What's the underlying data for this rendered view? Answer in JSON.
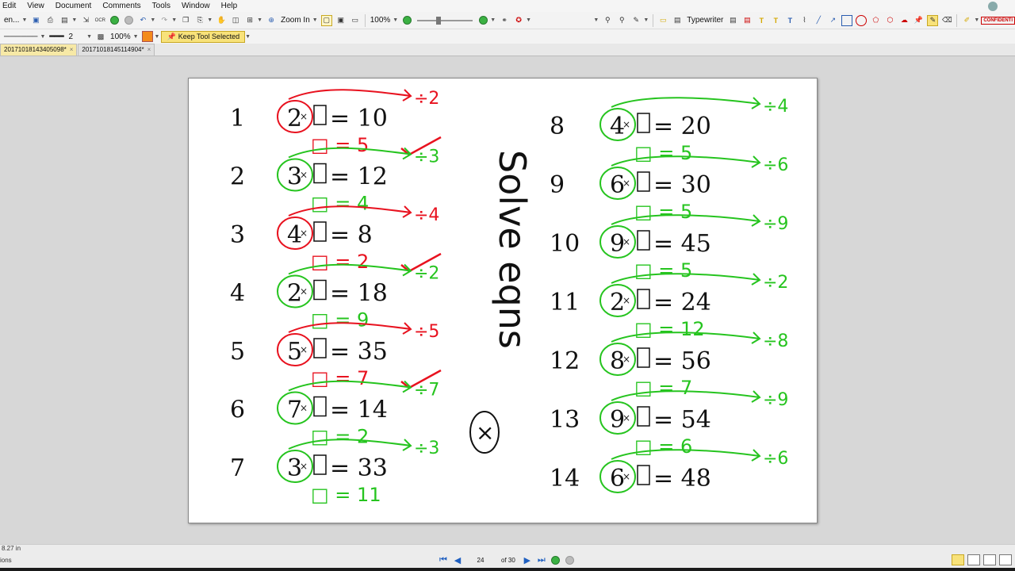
{
  "menu": [
    "Edit",
    "View",
    "Document",
    "Comments",
    "Tools",
    "Window",
    "Help"
  ],
  "toolbar": {
    "zoom_in_label": "Zoom In",
    "zoom_percent": "100%",
    "typewriter_label": "Typewriter",
    "confidential_label": "CONFIDENTI"
  },
  "toolbar2": {
    "left_label": "en...",
    "line_width": "2",
    "opacity": "100%",
    "keep_tool": "Keep Tool Selected"
  },
  "tabs": [
    {
      "label": "20171018143405098*",
      "active": true
    },
    {
      "label": "20171018145114904*",
      "active": false
    }
  ],
  "status": {
    "page_size": "8.27 in",
    "options_label": "ions",
    "current_page": "24",
    "of_pages": "of 30"
  },
  "worksheet": {
    "left": [
      {
        "n": "1",
        "a": "2",
        "p": "10",
        "ann": "÷2",
        "ans": "□ = 5",
        "col": "red"
      },
      {
        "n": "2",
        "a": "3",
        "p": "12",
        "ann": "÷3",
        "ans": "□ = 4",
        "col": "green"
      },
      {
        "n": "3",
        "a": "4",
        "p": "8",
        "ann": "÷4",
        "ans": "□ = 2",
        "col": "red"
      },
      {
        "n": "4",
        "a": "2",
        "p": "18",
        "ann": "÷2",
        "ans": "□ = 9",
        "col": "green"
      },
      {
        "n": "5",
        "a": "5",
        "p": "35",
        "ann": "÷5",
        "ans": "□ = 7",
        "col": "red"
      },
      {
        "n": "6",
        "a": "7",
        "p": "14",
        "ann": "÷7",
        "ans": "□ = 2",
        "col": "green"
      },
      {
        "n": "7",
        "a": "3",
        "p": "33",
        "ann": "÷3",
        "ans": "□ = 11",
        "col": "green"
      }
    ],
    "right": [
      {
        "n": "8",
        "a": "4",
        "p": "20",
        "ann": "÷4",
        "ans": "□ = 5",
        "col": "green"
      },
      {
        "n": "9",
        "a": "6",
        "p": "30",
        "ann": "÷6",
        "ans": "□ = 5",
        "col": "green"
      },
      {
        "n": "10",
        "a": "9",
        "p": "45",
        "ann": "÷9",
        "ans": "□ = 5",
        "col": "green"
      },
      {
        "n": "11",
        "a": "2",
        "p": "24",
        "ann": "÷2",
        "ans": "□ = 12",
        "col": "green"
      },
      {
        "n": "12",
        "a": "8",
        "p": "56",
        "ann": "÷8",
        "ans": "□ = 7",
        "col": "green"
      },
      {
        "n": "13",
        "a": "9",
        "p": "54",
        "ann": "÷9",
        "ans": "□ = 6",
        "col": "green"
      },
      {
        "n": "14",
        "a": "6",
        "p": "48",
        "ann": "÷6",
        "ans": "",
        "col": "green"
      }
    ],
    "center_note": "Solve eqns",
    "circled_symbol": "×",
    "colors": {
      "red": "#e8121f",
      "green": "#26c41f"
    }
  }
}
